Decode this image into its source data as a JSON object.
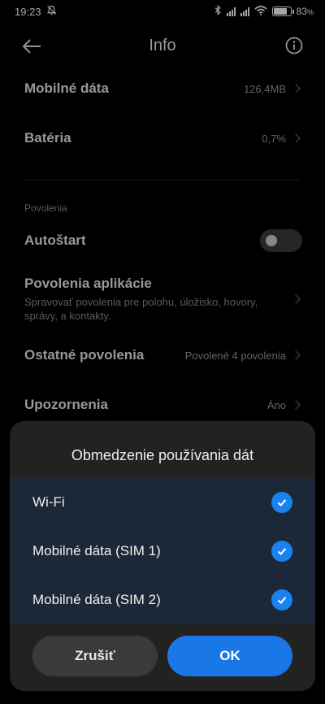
{
  "status_bar": {
    "time": "19:23",
    "battery_text": "83",
    "battery_unit": "%",
    "battery_level": 0.83
  },
  "header": {
    "title": "Info"
  },
  "rows": {
    "mobile_data": {
      "title": "Mobilné dáta",
      "value": "126,4MB"
    },
    "battery": {
      "title": "Batéria",
      "value": "0,7%"
    },
    "section_label": "Povolenia",
    "autostart": {
      "title": "Autoštart",
      "enabled": false
    },
    "app_permissions": {
      "title": "Povolenia aplikácie",
      "desc": "Spravovať povolenia pre polohu, úložisko, hovory, správy, a kontakty."
    },
    "other_permissions": {
      "title": "Ostatné povolenia",
      "value": "Povolené 4 povolenia"
    },
    "notifications": {
      "title": "Upozornenia",
      "value": "Áno"
    }
  },
  "sheet": {
    "title": "Obmedzenie používania dát",
    "options": [
      {
        "label": "Wi-Fi",
        "checked": true
      },
      {
        "label": "Mobilné dáta (SIM 1)",
        "checked": true
      },
      {
        "label": "Mobilné dáta (SIM 2)",
        "checked": true
      }
    ],
    "cancel_label": "Zrušiť",
    "ok_label": "OK"
  },
  "colors": {
    "accent": "#1a82f0",
    "sheet_bg": "#222222",
    "options_bg": "#1c2837"
  }
}
